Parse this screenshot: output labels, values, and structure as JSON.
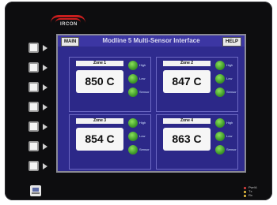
{
  "brand": {
    "logo_text": "IRCON",
    "accent_color": "#c81e1e"
  },
  "header": {
    "main_label": "MAIN",
    "title": "Modline 5 Multi-Sensor Interface",
    "help_label": "HELP"
  },
  "zones": [
    {
      "label": "Zone 1",
      "value": "850 C",
      "leds": [
        "High",
        "Low",
        "Sensor"
      ]
    },
    {
      "label": "Zone 2",
      "value": "847 C",
      "leds": [
        "High",
        "Low",
        "Sensor"
      ]
    },
    {
      "label": "Zone 3",
      "value": "854 C",
      "leds": [
        "High",
        "Low",
        "Sensor"
      ]
    },
    {
      "label": "Zone 4",
      "value": "863 C",
      "leds": [
        "High",
        "Low",
        "Sensor"
      ]
    }
  ],
  "legend": [
    {
      "text": "Pwr/A",
      "color": "#e04040"
    },
    {
      "text": "Tx",
      "color": "#e8c040"
    },
    {
      "text": "Rx",
      "color": "#e8c040"
    }
  ],
  "colors": {
    "screen_bg": "#2f2b8e",
    "led_on": "#3f9a2a"
  }
}
